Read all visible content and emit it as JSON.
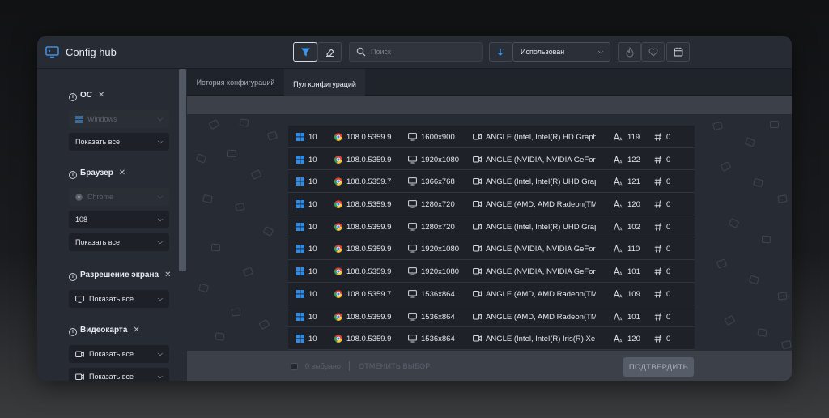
{
  "app": {
    "title": "Config hub"
  },
  "toolbar": {
    "search_placeholder": "Поиск",
    "sort_value": "Использован"
  },
  "sidebar": {
    "os": {
      "title": "ОС",
      "select_value": "Windows",
      "show_all": "Показать все"
    },
    "browser": {
      "title": "Браузер",
      "select_value": "Chrome",
      "version": "108",
      "show_all": "Показать все"
    },
    "resolution": {
      "title": "Разрешение экрана",
      "show_all": "Показать все"
    },
    "gpu": {
      "title": "Видеокарта",
      "show_all_1": "Показать все",
      "show_all_2": "Показать все"
    }
  },
  "tabs": [
    {
      "label": "История конфигураций",
      "active": false
    },
    {
      "label": "Пул конфигураций",
      "active": true
    }
  ],
  "table": {
    "rows": [
      {
        "os": "10",
        "browser": "108.0.5359.9",
        "resolution": "1600x900",
        "gpu": "ANGLE (Intel, Intel(R) HD Graphics",
        "fonts": "119",
        "hash": "0"
      },
      {
        "os": "10",
        "browser": "108.0.5359.9",
        "resolution": "1920x1080",
        "gpu": "ANGLE (NVIDIA, NVIDIA GeForce",
        "fonts": "122",
        "hash": "0"
      },
      {
        "os": "10",
        "browser": "108.0.5359.7",
        "resolution": "1366x768",
        "gpu": "ANGLE (Intel, Intel(R) UHD Graphi",
        "fonts": "121",
        "hash": "0"
      },
      {
        "os": "10",
        "browser": "108.0.5359.9",
        "resolution": "1280x720",
        "gpu": "ANGLE (AMD, AMD Radeon(TM)",
        "fonts": "120",
        "hash": "0"
      },
      {
        "os": "10",
        "browser": "108.0.5359.9",
        "resolution": "1280x720",
        "gpu": "ANGLE (Intel, Intel(R) UHD Graphi",
        "fonts": "102",
        "hash": "0"
      },
      {
        "os": "10",
        "browser": "108.0.5359.9",
        "resolution": "1920x1080",
        "gpu": "ANGLE (NVIDIA, NVIDIA GeForce",
        "fonts": "110",
        "hash": "0"
      },
      {
        "os": "10",
        "browser": "108.0.5359.9",
        "resolution": "1920x1080",
        "gpu": "ANGLE (NVIDIA, NVIDIA GeForce",
        "fonts": "101",
        "hash": "0"
      },
      {
        "os": "10",
        "browser": "108.0.5359.7",
        "resolution": "1536x864",
        "gpu": "ANGLE (AMD, AMD Radeon(TM)",
        "fonts": "109",
        "hash": "0"
      },
      {
        "os": "10",
        "browser": "108.0.5359.9",
        "resolution": "1536x864",
        "gpu": "ANGLE (AMD, AMD Radeon(TM)",
        "fonts": "101",
        "hash": "0"
      },
      {
        "os": "10",
        "browser": "108.0.5359.9",
        "resolution": "1536x864",
        "gpu": "ANGLE (Intel, Intel(R) Iris(R) Xe G",
        "fonts": "120",
        "hash": "0"
      }
    ]
  },
  "footer": {
    "selected_count": "0 выбрано",
    "cancel_selection": "ОТМЕНИТЬ ВЫБОР",
    "confirm_label": "ПОДТВЕРДИТЬ"
  },
  "colors": {
    "accent": "#2e8de8",
    "background": "#23272f"
  }
}
